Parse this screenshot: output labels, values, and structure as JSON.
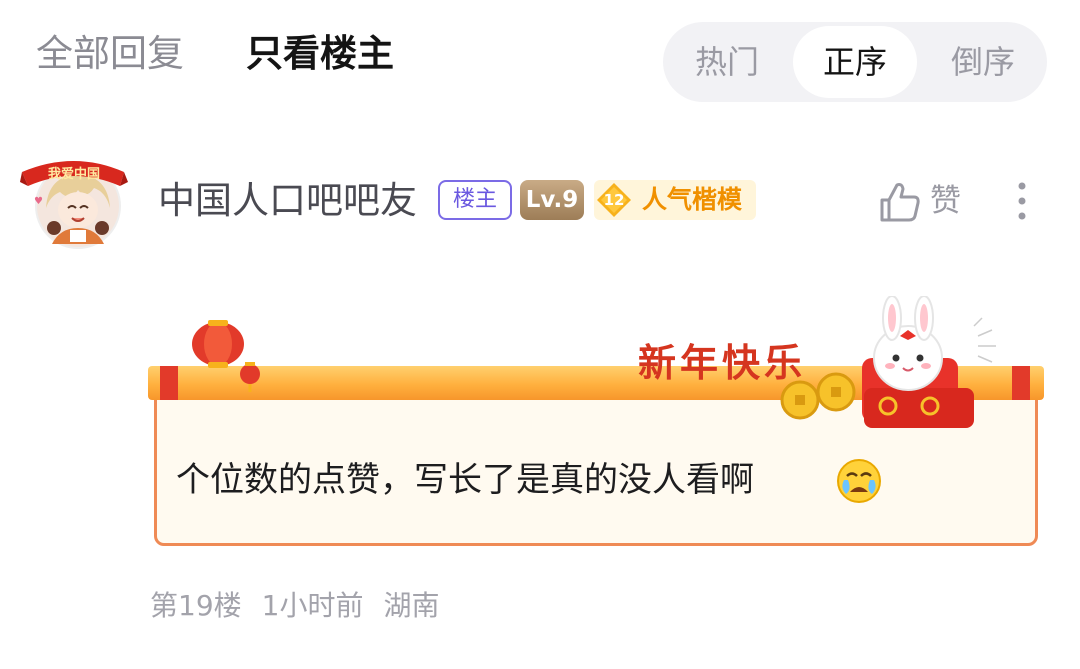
{
  "filter_tabs": [
    {
      "label": "全部回复",
      "active": false
    },
    {
      "label": "只看楼主",
      "active": true
    }
  ],
  "sort_options": [
    {
      "label": "热门",
      "active": false
    },
    {
      "label": "正序",
      "active": true
    },
    {
      "label": "倒序",
      "active": false
    }
  ],
  "post": {
    "avatar_caption": "我爱中国",
    "username": "中国人口吧吧友",
    "owner_badge": "楼主",
    "level_badge": "Lv.9",
    "popularity": {
      "number": "12",
      "label": "人气楷模"
    },
    "like_label": "赞",
    "like_icon": "thumbs-up-icon",
    "more_icon": "more-vertical-icon",
    "bubble_greeting": "新年快乐",
    "comment_text": "个位数的点赞，写长了是真的没人看啊",
    "emoji_icon": "crying-face-emoji",
    "floor": "第19楼",
    "time": "1小时前",
    "location": "湖南"
  },
  "colors": {
    "owner_badge": "#6a58e0",
    "popularity": "#f09000",
    "bubble_border": "#ef8a55",
    "greeting": "#d5351f"
  }
}
